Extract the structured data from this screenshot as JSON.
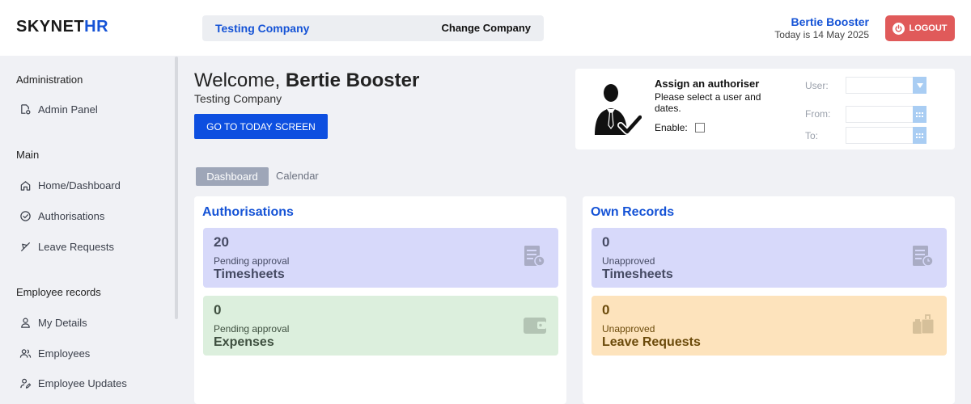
{
  "app": {
    "logo_main": "SKYNET",
    "logo_accent": "HR"
  },
  "header": {
    "company": "Testing Company",
    "change_company": "Change Company",
    "user_name": "Bertie Booster",
    "today": "Today is 14 May 2025",
    "logout": "LOGOUT"
  },
  "sidebar": {
    "sections": [
      {
        "title": "Administration",
        "items": [
          {
            "label": "Admin Panel",
            "icon": "admin-gear-icon"
          }
        ]
      },
      {
        "title": "Main",
        "items": [
          {
            "label": "Home/Dashboard",
            "icon": "home-icon"
          },
          {
            "label": "Authorisations",
            "icon": "check-circle-icon"
          },
          {
            "label": "Leave Requests",
            "icon": "plane-icon"
          }
        ]
      },
      {
        "title": "Employee records",
        "items": [
          {
            "label": "My Details",
            "icon": "user-icon"
          },
          {
            "label": "Employees",
            "icon": "users-icon"
          },
          {
            "label": "Employee Updates",
            "icon": "user-edit-icon"
          }
        ]
      }
    ]
  },
  "welcome": {
    "greeting": "Welcome, ",
    "name": "Bertie Booster",
    "company": "Testing Company",
    "today_button": "GO TO TODAY SCREEN"
  },
  "authoriser": {
    "title": "Assign an authoriser",
    "description": "Please select a user and dates.",
    "enable_label": "Enable:",
    "user_label": "User:",
    "from_label": "From:",
    "to_label": "To:"
  },
  "tabs": [
    {
      "label": "Dashboard",
      "active": true
    },
    {
      "label": "Calendar",
      "active": false
    }
  ],
  "cards": {
    "authorisations": {
      "title": "Authorisations",
      "tiles": [
        {
          "count": "20",
          "sub": "Pending approval",
          "label": "Timesheets",
          "color": "#d7d9fa"
        },
        {
          "count": "0",
          "sub": "Pending approval",
          "label": "Expenses",
          "color": "#dcefdd"
        }
      ]
    },
    "own_records": {
      "title": "Own Records",
      "tiles": [
        {
          "count": "0",
          "sub": "Unapproved",
          "label": "Timesheets",
          "color": "#d7d9fa"
        },
        {
          "count": "0",
          "sub": "Unapproved",
          "label": "Leave Requests",
          "color": "#fde3bc"
        }
      ]
    }
  },
  "colors": {
    "accent": "#1553d6",
    "primary_button": "#0d4fe0",
    "logout": "#e05a5a"
  }
}
